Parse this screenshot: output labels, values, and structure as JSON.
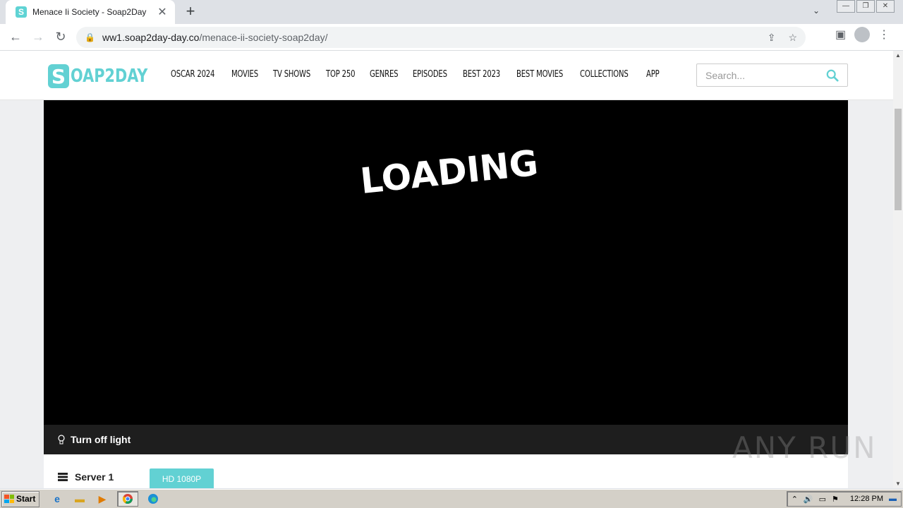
{
  "browser": {
    "tab_title": "Menace Ii Society - Soap2Day",
    "url_host": "ww1.soap2day-day.co",
    "url_path": "/menace-ii-society-soap2day/"
  },
  "site": {
    "logo_letter": "S",
    "logo_text": "OAP2DAY",
    "nav": [
      "OSCAR 2024",
      "MOVIES",
      "TV SHOWS",
      "TOP 250",
      "GENRES",
      "EPISODES",
      "BEST 2023",
      "BEST MOVIES",
      "COLLECTIONS",
      "APP"
    ],
    "search_placeholder": "Search...",
    "accent_color": "#62d1d3"
  },
  "player": {
    "loading_text": "LOADING",
    "light_toggle": "Turn off light"
  },
  "servers": {
    "label": "Server 1",
    "quality_button": "HD 1080P"
  },
  "watermark": "ANY RUN",
  "taskbar": {
    "start_label": "Start",
    "clock": "12:28 PM"
  }
}
